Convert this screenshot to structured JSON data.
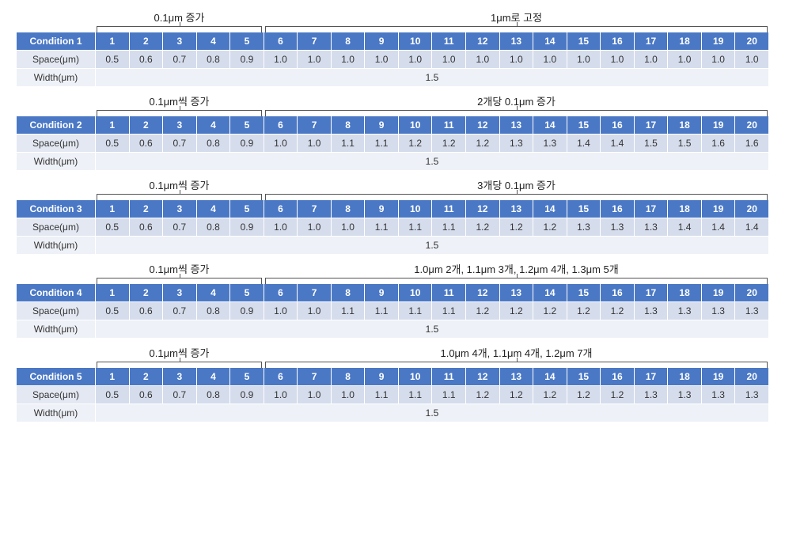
{
  "chart_data": {
    "type": "table",
    "title": "Condition spacing tables",
    "columns": [
      "1",
      "2",
      "3",
      "4",
      "5",
      "6",
      "7",
      "8",
      "9",
      "10",
      "11",
      "12",
      "13",
      "14",
      "15",
      "16",
      "17",
      "18",
      "19",
      "20"
    ],
    "row_headers": [
      "Space(μm)",
      "Width(μm)"
    ],
    "conditions": [
      {
        "name": "Condition 1",
        "annot_left": "0.1μm 증가",
        "annot_right": "1μm로 고정",
        "space": [
          "0.5",
          "0.6",
          "0.7",
          "0.8",
          "0.9",
          "1.0",
          "1.0",
          "1.0",
          "1.0",
          "1.0",
          "1.0",
          "1.0",
          "1.0",
          "1.0",
          "1.0",
          "1.0",
          "1.0",
          "1.0",
          "1.0",
          "1.0"
        ],
        "width": "1.5"
      },
      {
        "name": "Condition 2",
        "annot_left": "0.1μm씩 증가",
        "annot_right": "2개당 0.1μm 증가",
        "space": [
          "0.5",
          "0.6",
          "0.7",
          "0.8",
          "0.9",
          "1.0",
          "1.0",
          "1.1",
          "1.1",
          "1.2",
          "1.2",
          "1.2",
          "1.3",
          "1.3",
          "1.4",
          "1.4",
          "1.5",
          "1.5",
          "1.6",
          "1.6"
        ],
        "width": "1.5"
      },
      {
        "name": "Condition 3",
        "annot_left": "0.1μm씩 증가",
        "annot_right": "3개당 0.1μm 증가",
        "space": [
          "0.5",
          "0.6",
          "0.7",
          "0.8",
          "0.9",
          "1.0",
          "1.0",
          "1.0",
          "1.1",
          "1.1",
          "1.1",
          "1.2",
          "1.2",
          "1.2",
          "1.3",
          "1.3",
          "1.3",
          "1.4",
          "1.4",
          "1.4"
        ],
        "width": "1.5"
      },
      {
        "name": "Condition 4",
        "annot_left": "0.1μm씩 증가",
        "annot_right": "1.0μm 2개, 1.1μm 3개, 1.2μm 4개, 1.3μm 5개",
        "space": [
          "0.5",
          "0.6",
          "0.7",
          "0.8",
          "0.9",
          "1.0",
          "1.0",
          "1.1",
          "1.1",
          "1.1",
          "1.1",
          "1.2",
          "1.2",
          "1.2",
          "1.2",
          "1.2",
          "1.3",
          "1.3",
          "1.3",
          "1.3"
        ],
        "width": "1.5"
      },
      {
        "name": "Condition 5",
        "annot_left": "0.1μm씩 증가",
        "annot_right": "1.0μm 4개, 1.1μm 4개, 1.2μm 7개",
        "space": [
          "0.5",
          "0.6",
          "0.7",
          "0.8",
          "0.9",
          "1.0",
          "1.0",
          "1.0",
          "1.1",
          "1.1",
          "1.1",
          "1.2",
          "1.2",
          "1.2",
          "1.2",
          "1.2",
          "1.3",
          "1.3",
          "1.3",
          "1.3"
        ],
        "width": "1.5"
      }
    ]
  }
}
